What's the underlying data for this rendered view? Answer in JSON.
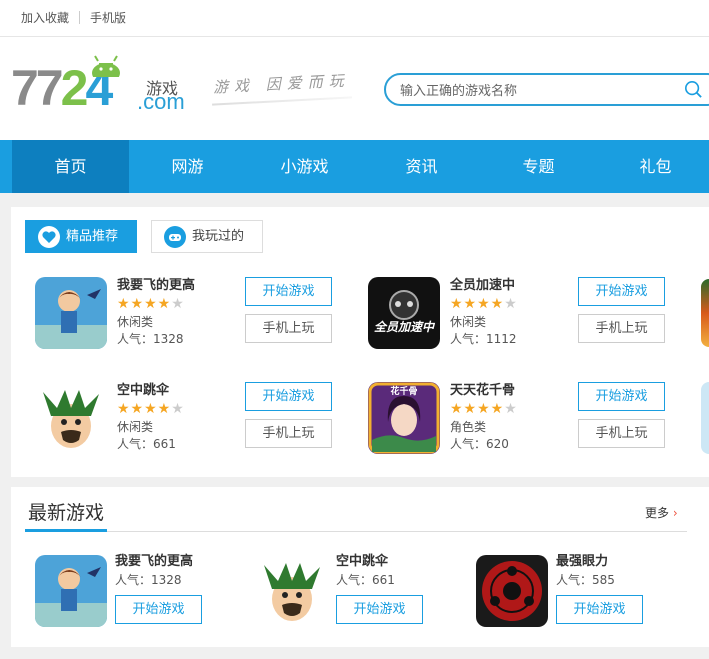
{
  "topbar": {
    "bookmark": "加入收藏",
    "mobile_version": "手机版"
  },
  "logo": {
    "number_a": "77",
    "number_b": "2",
    "number_c": "4",
    "sub1": "游戏",
    "sub2": ".com",
    "slogan": "游戏 因爱而玩"
  },
  "search": {
    "placeholder": "输入正确的游戏名称"
  },
  "nav": [
    "首页",
    "网游",
    "小游戏",
    "资讯",
    "专题",
    "礼包"
  ],
  "tabs": {
    "featured": "精品推荐",
    "played": "我玩过的"
  },
  "buttons": {
    "play": "开始游戏",
    "mobile": "手机上玩"
  },
  "featured_games": [
    {
      "name": "我要飞的更高",
      "rating": 4,
      "category": "休闲类",
      "popularity": "人气：1328"
    },
    {
      "name": "全员加速中",
      "rating": 4,
      "category": "休闲类",
      "popularity": "人气：1112"
    },
    {
      "name": "空中跳伞",
      "rating": 4,
      "category": "休闲类",
      "popularity": "人气：661"
    },
    {
      "name": "天天花千骨",
      "rating": 4,
      "category": "角色类",
      "popularity": "人气：620"
    }
  ],
  "thumb_texts": {
    "speed": "全员加速中",
    "huaqiangu": "花千骨"
  },
  "newest": {
    "title": "最新游戏",
    "more": "更多",
    "games": [
      {
        "name": "我要飞的更高",
        "popularity": "人气：1328"
      },
      {
        "name": "空中跳伞",
        "popularity": "人气：661"
      },
      {
        "name": "最强眼力",
        "popularity": "人气：585"
      }
    ]
  },
  "colors": {
    "accent": "#1a9ee0",
    "nav_active": "#0d7fbf",
    "star": "#f5a623",
    "logo_green": "#7cc04a"
  }
}
